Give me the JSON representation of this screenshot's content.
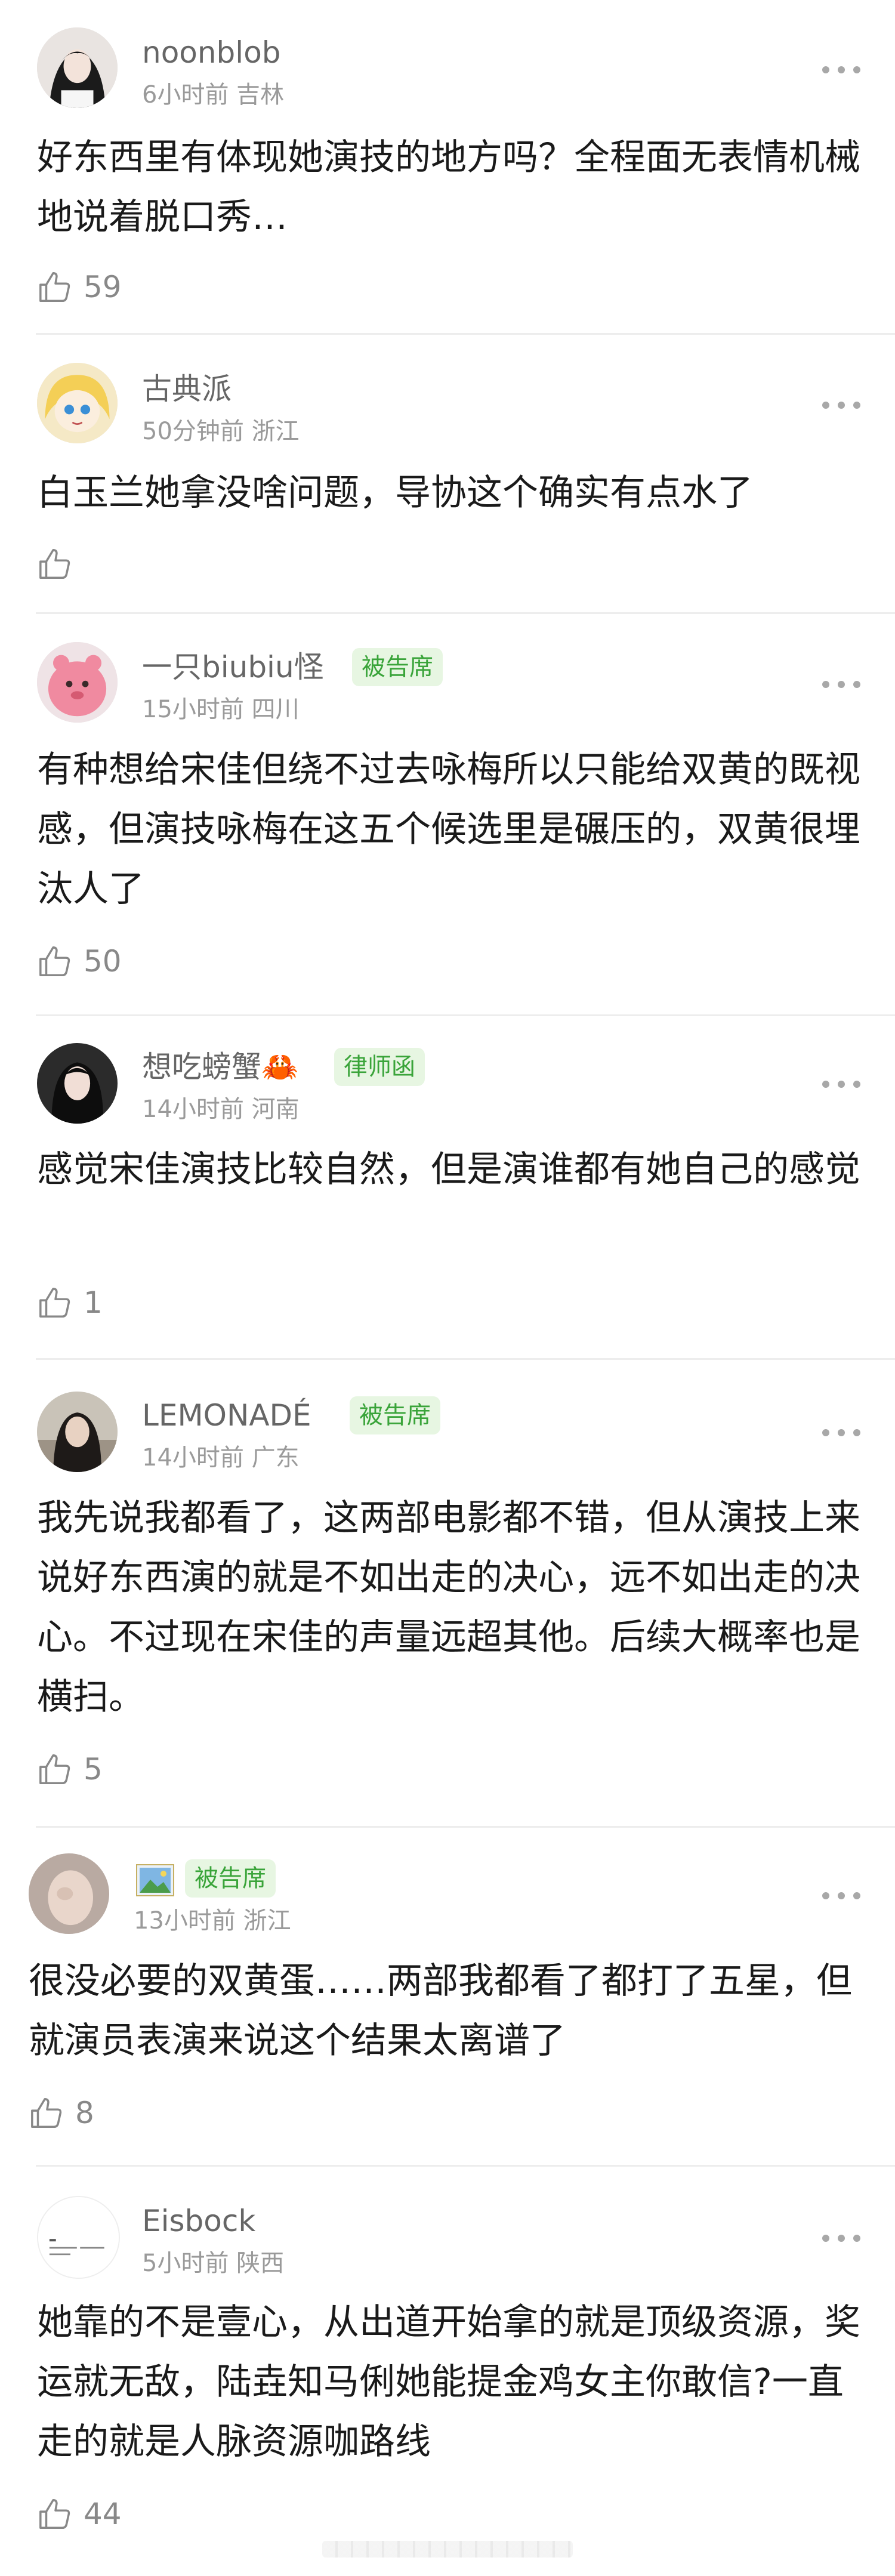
{
  "colors": {
    "username": "#666666",
    "meta": "#9a9a9a",
    "text": "#1a1a1a",
    "badge_bg": "#e7f6e2",
    "badge_fg": "#3aa43a",
    "divider": "#ededed"
  },
  "comments": [
    {
      "username": "noonblob",
      "meta": "6小时前 吉林",
      "text": "好东西里有体现她演技的地方吗？全程面无表情机械地说着脱口秀…",
      "likes": "59",
      "avatar": "avatar-dark-hair-girl"
    },
    {
      "username": "古典派",
      "meta": "50分钟前 浙江",
      "text": "白玉兰她拿没啥问题，导协这个确实有点水了",
      "likes": "",
      "avatar": "avatar-cartoon-blonde"
    },
    {
      "username": "一只biubiu怪",
      "badge": "被告席",
      "meta": "15小时前 四川",
      "text": "有种想给宋佳但绕不过去咏梅所以只能给双黄的既视感，但演技咏梅在这五个候选里是碾压的，双黄很埋汰人了",
      "likes": "50",
      "avatar": "avatar-pink-creature"
    },
    {
      "username": "想吃螃蟹🦀",
      "badge": "律师函",
      "meta": "14小时前 河南",
      "text": "感觉宋佳演技比较自然，但是演谁都有她自己的感觉",
      "likes": "1",
      "avatar": "avatar-woman-portrait"
    },
    {
      "username": "LEMONADÉ",
      "badge": "被告席",
      "meta": "14小时前 广东",
      "text": "我先说我都看了，这两部电影都不错，但从演技上来说好东西演的就是不如出走的决心，远不如出走的决心。不过现在宋佳的声量远超其他。后续大概率也是横扫。",
      "likes": "5",
      "avatar": "avatar-woman-long-hair"
    },
    {
      "username": "",
      "badge": "被告席",
      "meta": "13小时前 浙江",
      "text": "很没必要的双黄蛋……两部我都看了都打了五星，但就演员表演来说这个结果太离谱了",
      "likes": "8",
      "avatar": "avatar-blurry-face",
      "name_icon": "picture-icon"
    },
    {
      "username": "Eisbock",
      "meta": "5小时前 陕西",
      "text": "她靠的不是壹心，从出道开始拿的就是顶级资源，奖运就无敌，陆垚知马俐她能提金鸡女主你敢信?一直走的就是人脉资源咖路线",
      "likes": "44",
      "avatar": "avatar-text-circle"
    }
  ]
}
